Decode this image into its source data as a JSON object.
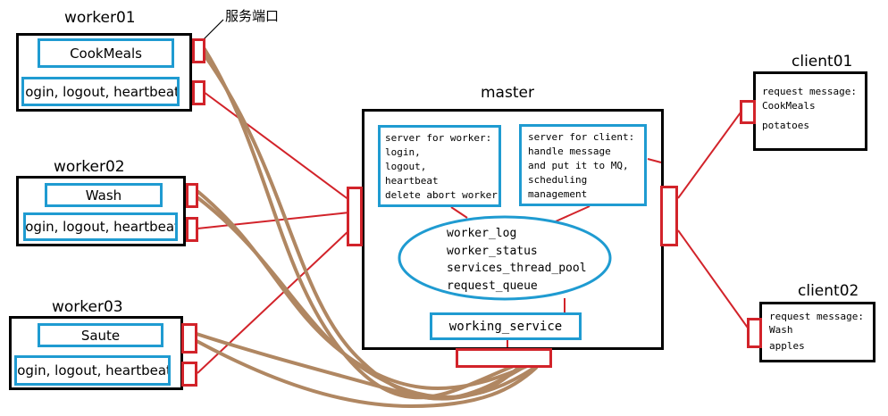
{
  "annotation": "服务端口",
  "workers": [
    {
      "name": "worker01",
      "service": "CookMeals",
      "heartbeat": "login, logout, heartbeat"
    },
    {
      "name": "worker02",
      "service": "Wash",
      "heartbeat": "login, logout, heartbeat"
    },
    {
      "name": "worker03",
      "service": "Saute",
      "heartbeat": "login, logout, heartbeat"
    }
  ],
  "master": {
    "title": "master",
    "server_for_worker": [
      "server for worker:",
      "login,",
      "logout,",
      "heartbeat",
      "delete abort worker"
    ],
    "server_for_client": [
      "server for client:",
      "handle message",
      "and put it to MQ,",
      "scheduling",
      "management"
    ],
    "state": [
      "worker_log",
      "worker_status",
      "services_thread_pool",
      "request_queue"
    ],
    "working_service": "working_service"
  },
  "clients": [
    {
      "name": "client01",
      "lines": [
        "request message:",
        "CookMeals",
        "potatoes"
      ]
    },
    {
      "name": "client02",
      "lines": [
        "request message:",
        "Wash",
        "apples"
      ]
    }
  ],
  "colors": {
    "frame": "#000000",
    "service_box": "#1f9bd1",
    "port": "#d2232a",
    "worker_link": "#d2232a",
    "service_link": "#b08762"
  }
}
